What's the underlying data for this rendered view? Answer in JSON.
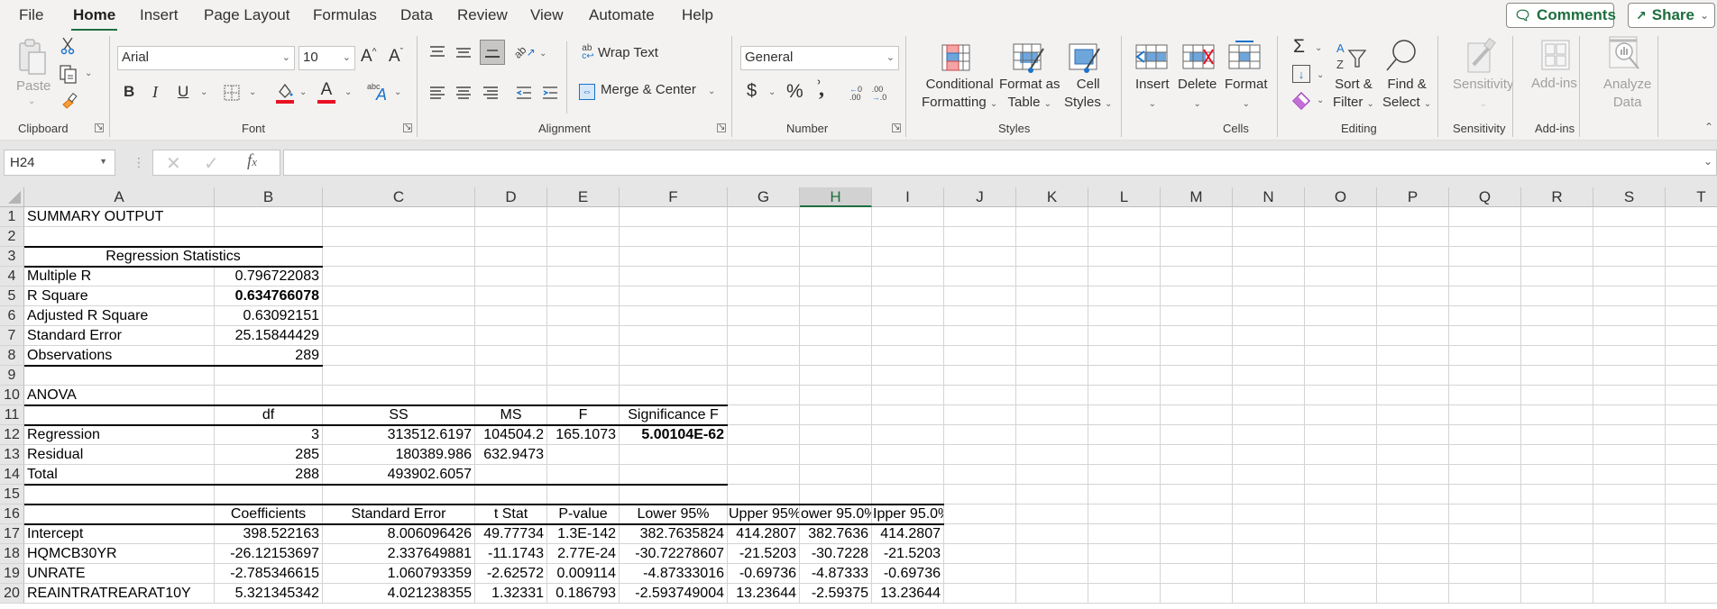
{
  "menu": {
    "tabs": [
      "File",
      "Home",
      "Insert",
      "Page Layout",
      "Formulas",
      "Data",
      "Review",
      "View",
      "Automate",
      "Help"
    ],
    "active": "Home",
    "comments_label": "Comments",
    "share_label": "Share"
  },
  "ribbon": {
    "clipboard": {
      "label": "Clipboard",
      "paste": "Paste"
    },
    "font": {
      "label": "Font",
      "font_name": "Arial",
      "font_size": "10",
      "bold": "B",
      "italic": "I",
      "underline": "U",
      "grow": "A",
      "shrink": "A",
      "font_color_letter": "A",
      "fill_color": "#e81123",
      "text_color": "#e81123"
    },
    "alignment": {
      "label": "Alignment",
      "wrap_text": "Wrap Text",
      "merge_center": "Merge & Center"
    },
    "number": {
      "label": "Number",
      "format": "General",
      "currency": "$",
      "percent": "%",
      "comma": "9",
      "inc_decimal": "←0 .00",
      "dec_decimal": ".00 →0"
    },
    "styles": {
      "label": "Styles",
      "conditional": [
        "Conditional",
        "Formatting"
      ],
      "format_table": [
        "Format as",
        "Table"
      ],
      "cell_styles": [
        "Cell",
        "Styles"
      ]
    },
    "cells": {
      "label": "Cells",
      "insert": "Insert",
      "delete": "Delete",
      "format": "Format"
    },
    "editing": {
      "label": "Editing",
      "sort_filter": [
        "Sort &",
        "Filter"
      ],
      "find_select": [
        "Find &",
        "Select"
      ]
    },
    "sensitivity": {
      "label": "Sensitivity",
      "button": "Sensitivity"
    },
    "addins": {
      "label": "Add-ins",
      "button": "Add-ins"
    },
    "analyze": {
      "button": [
        "Analyze",
        "Data"
      ]
    }
  },
  "formula_bar": {
    "name_box": "H24",
    "formula": ""
  },
  "sheet": {
    "columns": [
      "A",
      "B",
      "C",
      "D",
      "E",
      "F",
      "G",
      "H",
      "I",
      "J",
      "K",
      "L",
      "M",
      "N",
      "O",
      "P",
      "Q",
      "R",
      "S",
      "T"
    ],
    "selected_column": "H",
    "rows": [
      "1",
      "2",
      "3",
      "4",
      "5",
      "6",
      "7",
      "8",
      "9",
      "10",
      "11",
      "12",
      "13",
      "14",
      "15",
      "16",
      "17",
      "18",
      "19",
      "20"
    ],
    "cells": {
      "A1": "SUMMARY OUTPUT",
      "A3": "Regression Statistics",
      "A4": "Multiple R",
      "B4": "0.796722083",
      "A5": "R Square",
      "B5": "0.634766078",
      "A6": "Adjusted R Square",
      "B6": "0.63092151",
      "A7": "Standard Error",
      "B7": "25.15844429",
      "A8": "Observations",
      "B8": "289",
      "A10": "ANOVA",
      "B11": "df",
      "C11": "SS",
      "D11": "MS",
      "E11": "F",
      "F11": "Significance F",
      "A12": "Regression",
      "B12": "3",
      "C12": "313512.6197",
      "D12": "104504.2",
      "E12": "165.1073",
      "F12": "5.00104E-62",
      "A13": "Residual",
      "B13": "285",
      "C13": "180389.986",
      "D13": "632.9473",
      "A14": "Total",
      "B14": "288",
      "C14": "493902.6057",
      "B16": "Coefficients",
      "C16": "Standard Error",
      "D16": "t Stat",
      "E16": "P-value",
      "F16": "Lower 95%",
      "G16": "Upper 95%",
      "H16": "ower 95.0%",
      "I16": "Ipper 95.0%",
      "A17": "Intercept",
      "B17": "398.522163",
      "C17": "8.006096426",
      "D17": "49.77734",
      "E17": "1.3E-142",
      "F17": "382.7635824",
      "G17": "414.2807",
      "H17": "382.7636",
      "I17": "414.2807",
      "A18": "HQMCB30YR",
      "B18": "-26.12153697",
      "C18": "2.337649881",
      "D18": "-11.1743",
      "E18": "2.77E-24",
      "F18": "-30.72278607",
      "G18": "-21.5203",
      "H18": "-30.7228",
      "I18": "-21.5203",
      "A19": "UNRATE",
      "B19": "-2.785346615",
      "C19": "1.060793359",
      "D19": "-2.62572",
      "E19": "0.009114",
      "F19": "-4.87333016",
      "G19": "-0.69736",
      "H19": "-4.87333",
      "I19": "-0.69736",
      "A20": "REAINTRATREARAT10Y",
      "B20": "5.321345342",
      "C20": "4.021238355",
      "D20": "1.32331",
      "E20": "0.186793",
      "F20": "-2.593749004",
      "G20": "13.23644",
      "H20": "-2.59375",
      "I20": "13.23644"
    }
  }
}
